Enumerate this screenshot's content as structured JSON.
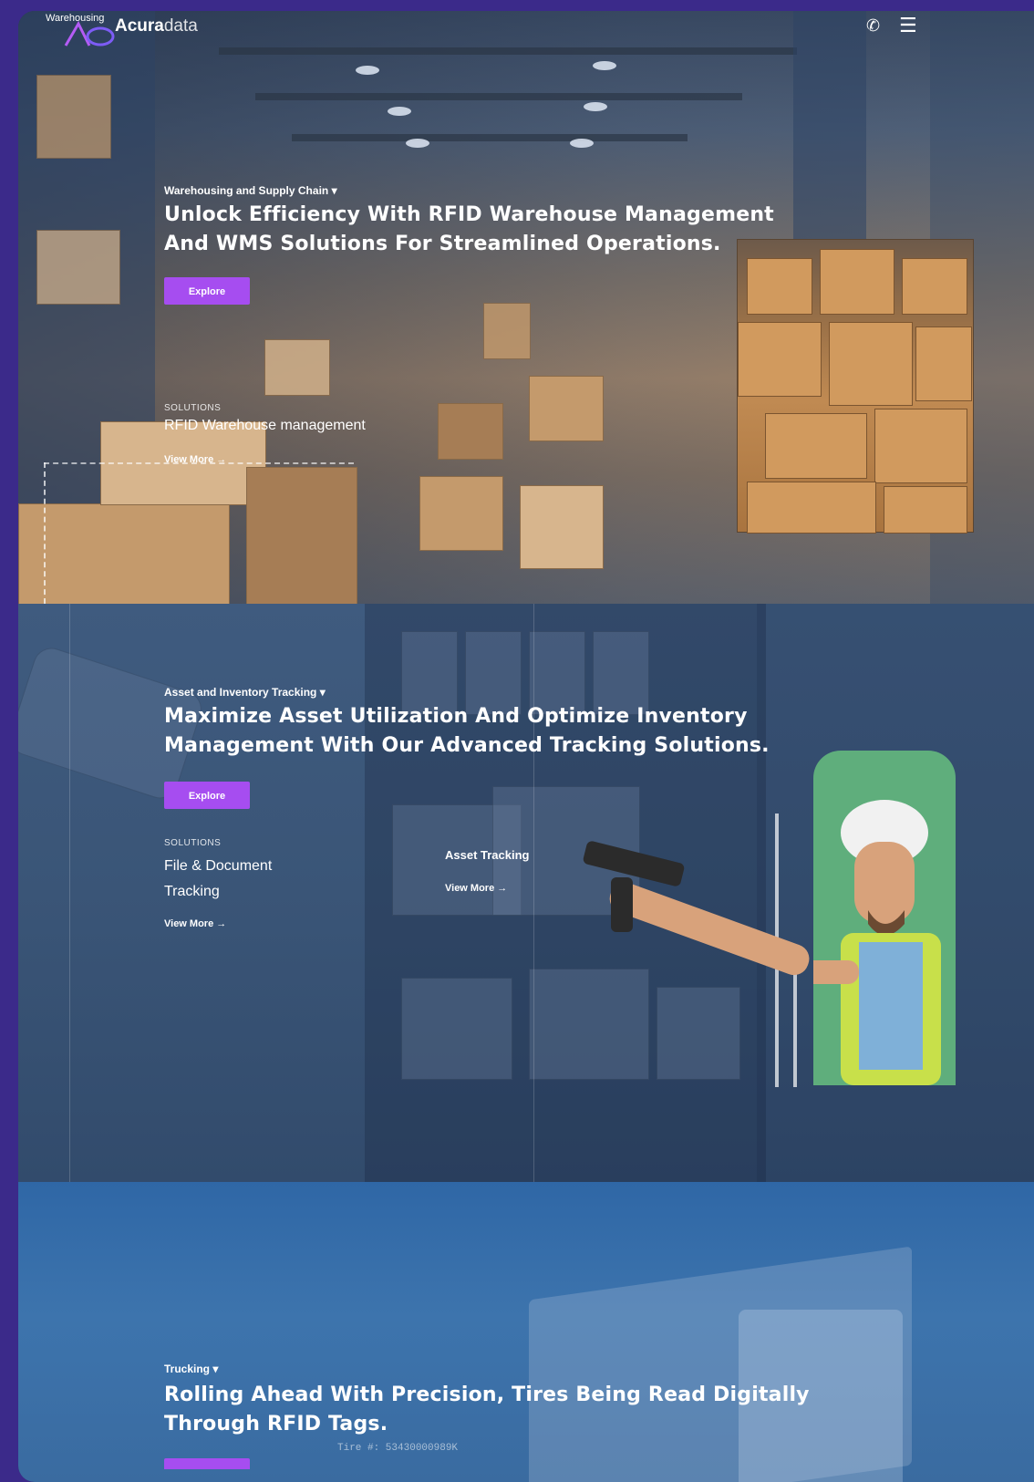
{
  "header": {
    "logo_small": "Warehousing",
    "logo_name_a": "Acura",
    "logo_name_b": "data",
    "phone_icon": "phone-icon",
    "menu_icon": "menu-icon"
  },
  "sections": [
    {
      "category": "Warehousing and Supply Chain ▾",
      "headline_line1": "Unlock Efficiency With RFID Warehouse Management",
      "headline_line2": "And WMS Solutions For Streamlined Operations.",
      "button": "Explore",
      "solutions_label": "SOLUTIONS",
      "solutions": [
        {
          "title": "RFID Warehouse management",
          "link": "View More →"
        }
      ]
    },
    {
      "category": "Asset and Inventory Tracking ▾",
      "headline_line1": "Maximize Asset Utilization And Optimize Inventory",
      "headline_line2": "Management With Our Advanced Tracking Solutions.",
      "button": "Explore",
      "solutions_label": "SOLUTIONS",
      "solutions": [
        {
          "title_line1": "File & Document",
          "title_line2": "Tracking",
          "link": "View More →"
        },
        {
          "title": "Asset Tracking",
          "link": "View More →"
        }
      ]
    },
    {
      "category": "Trucking ▾",
      "headline_line1": "Rolling Ahead With Precision, Tires Being Read Digitally",
      "headline_line2": "Through RFID Tags.",
      "tire_number": "Tire #: 53430000989K"
    }
  ],
  "colors": {
    "accent": "#a64df0",
    "frame": "#3b2a8a"
  }
}
